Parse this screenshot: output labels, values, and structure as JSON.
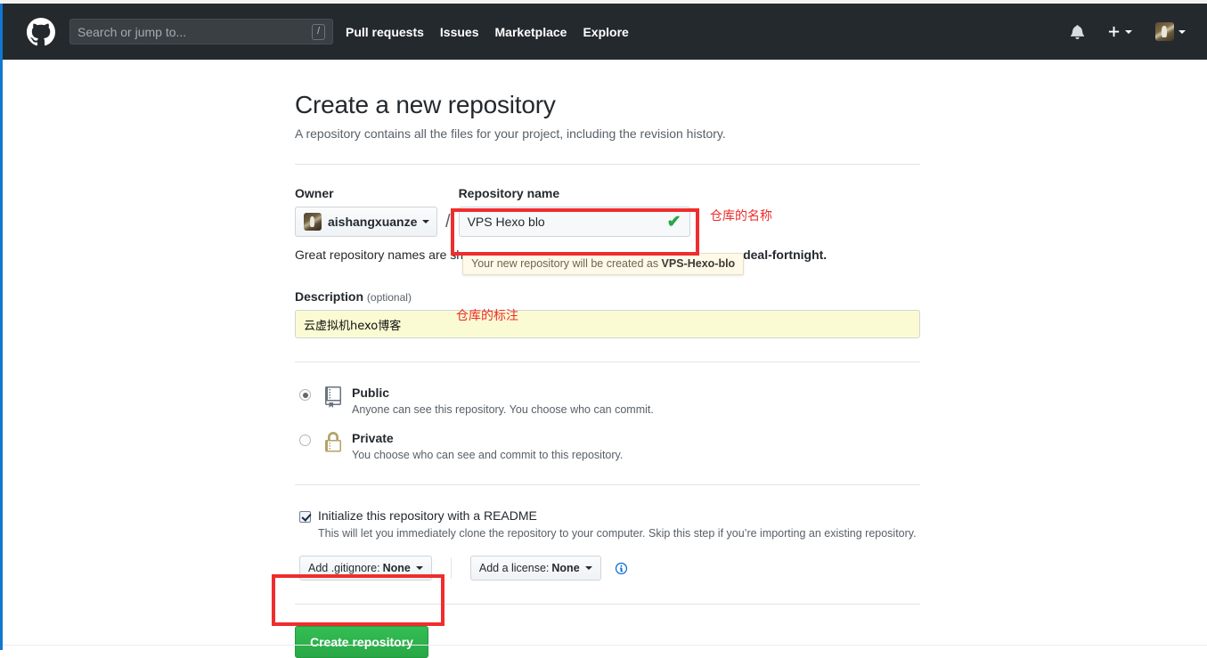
{
  "header": {
    "logo_name": "github-logo",
    "search": {
      "placeholder": "Search or jump to...",
      "shortcut_key": "/"
    },
    "nav": [
      {
        "label": "Pull requests"
      },
      {
        "label": "Issues"
      },
      {
        "label": "Marketplace"
      },
      {
        "label": "Explore"
      }
    ],
    "background": "#24292e"
  },
  "page": {
    "title": "Create a new repository",
    "subtitle": "A repository contains all the files for your project, including the revision history."
  },
  "form": {
    "owner": {
      "label": "Owner",
      "value": "aishangxuanze"
    },
    "separator": "/",
    "repo_name": {
      "label": "Repository name",
      "value": "VPS Hexo blo",
      "valid_mark": "✔"
    },
    "name_hint": {
      "before": "Great repository names are sh",
      "after": "deal-fortnight."
    },
    "tooltip": {
      "prefix": "Your new repository will be created as ",
      "repo": "VPS-Hexo-blo"
    },
    "description": {
      "label": "Description",
      "optional": "(optional)",
      "value": "云虚拟机hexo博客"
    },
    "visibility": [
      {
        "id": "public",
        "title": "Public",
        "desc": "Anyone can see this repository. You choose who can commit.",
        "selected": true,
        "icon": "repo-book-icon"
      },
      {
        "id": "private",
        "title": "Private",
        "desc": "You choose who can see and commit to this repository.",
        "selected": false,
        "icon": "lock-icon"
      }
    ],
    "readme": {
      "label": "Initialize this repository with a README",
      "desc": "This will let you immediately clone the repository to your computer. Skip this step if you’re importing an existing repository.",
      "checked": true
    },
    "gitignore": {
      "prefix": "Add .gitignore:",
      "value": "None"
    },
    "license": {
      "prefix": "Add a license:",
      "value": "None"
    },
    "submit_label": "Create repository"
  },
  "annotations": {
    "repo_name_note": "仓库的名称",
    "description_note": "仓库的标注",
    "box_color": "#ef2d2d"
  },
  "colors": {
    "accent_green": "#28a745",
    "header_bg": "#24292e",
    "annotation_red": "#ef2d2d",
    "autofill_yellow": "#fbfbd3",
    "tooltip_bg": "#fff9ea"
  }
}
